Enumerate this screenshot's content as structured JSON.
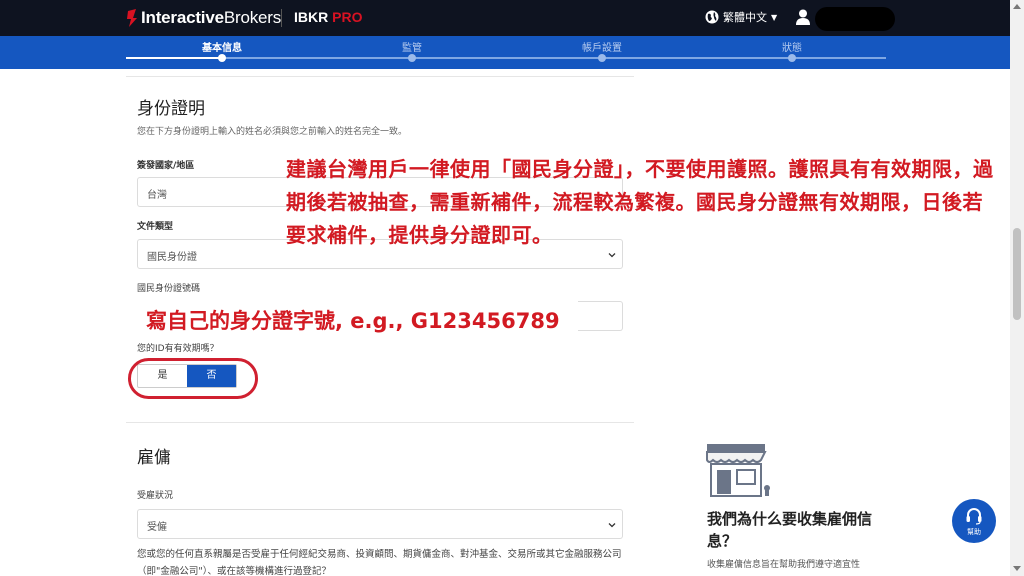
{
  "header": {
    "logo_bold": "Interactive",
    "logo_light": "Brokers",
    "product_ibkr": "IBKR",
    "product_pro": "PRO",
    "language": "繁體中文",
    "colors": {
      "bar": "#0e1320",
      "brand_red": "#d81222"
    }
  },
  "steps": [
    {
      "label": "基本信息",
      "active": true
    },
    {
      "label": "監管",
      "active": false
    },
    {
      "label": "帳戶設置",
      "active": false
    },
    {
      "label": "狀態",
      "active": false
    }
  ],
  "identity": {
    "title": "身份證明",
    "description": "您在下方身份證明上輸入的姓名必須與您之前輸入的姓名完全一致。",
    "country_label": "簽發國家/地區",
    "country_value": "台灣",
    "doc_type_label": "文件類型",
    "doc_type_value": "國民身份證",
    "id_number_label": "國民身份證號碼",
    "expiry_question": "您的ID有有效期嗎？",
    "toggle_yes": "是",
    "toggle_no": "否",
    "toggle_selected": "否"
  },
  "annotations": {
    "main_note": "建議台灣用戶一律使用「國民身分證」，不要使用護照。護照具有有效期限，過期後若被抽查，需重新補件，流程較為繁複。國民身分證無有效期限，日後若要求補件，提供身分證即可。",
    "id_note": "寫自己的身分證字號, e.g., G123456789",
    "color": "#d21a22"
  },
  "employment": {
    "title": "雇傭",
    "status_label": "受雇狀況",
    "status_value": "受僱",
    "question": "您或您的任何直系親屬是否受雇于任何經紀交易商、投資顧問、期貨傭金商、對沖基金、交易所或其它金融服務公司（即\"金融公司\"）、或在該等機構進行過登記？"
  },
  "aside": {
    "title": "我們為什么要收集雇佣信息？",
    "text": "收集雇傭信息旨在幫助我們遵守適宜性"
  },
  "help_button": {
    "label": "幫助",
    "icon": "headset-icon"
  }
}
